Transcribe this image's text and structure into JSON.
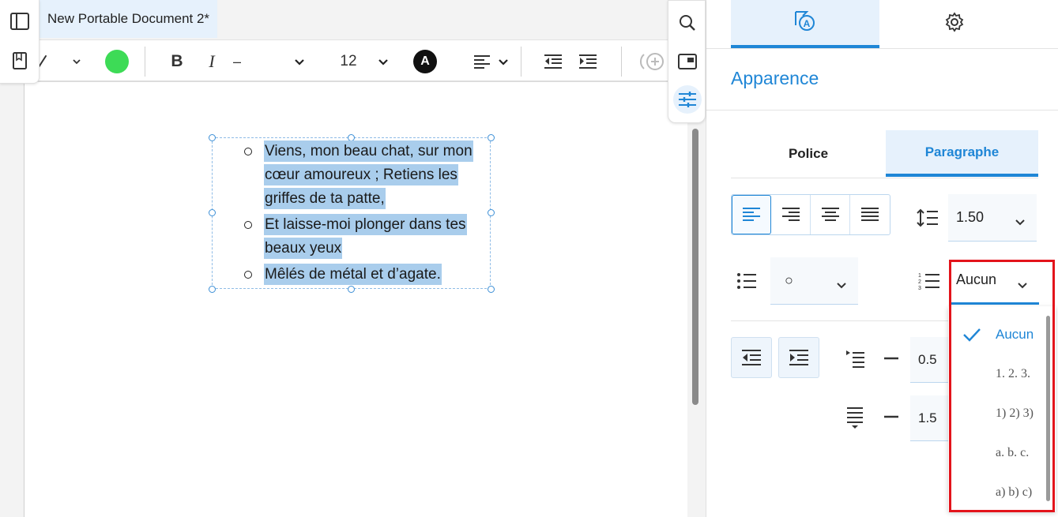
{
  "document_tab": {
    "title": "New Portable Document 2*"
  },
  "toolbar": {
    "font_size": "12",
    "text_color_letter": "A",
    "line_style": "–",
    "pen_color": "#3ddb56"
  },
  "document": {
    "list_lines": [
      "Viens, mon beau chat, sur mon",
      "cœur amoureux ; Retiens les",
      "griffes de ta patte,",
      "Et laisse-moi plonger dans tes",
      "beaux yeux",
      "Mêlés de métal et d’agate."
    ]
  },
  "panel": {
    "section_title": "Apparence",
    "subtabs": [
      "Police",
      "Paragraphe"
    ],
    "line_spacing": "1.50",
    "bullet_style": "○",
    "numbering": "Aucun",
    "indent_value": "0.5",
    "spacing_value": "1.5"
  },
  "numbering_dropdown": {
    "items": [
      "Aucun",
      "1. 2. 3.",
      "1) 2) 3)",
      "a. b. c.",
      "a) b) c)"
    ]
  },
  "colors": {
    "accent": "#1f86d6",
    "highlight": "#a9cdec",
    "annotation": "#e3141b"
  }
}
